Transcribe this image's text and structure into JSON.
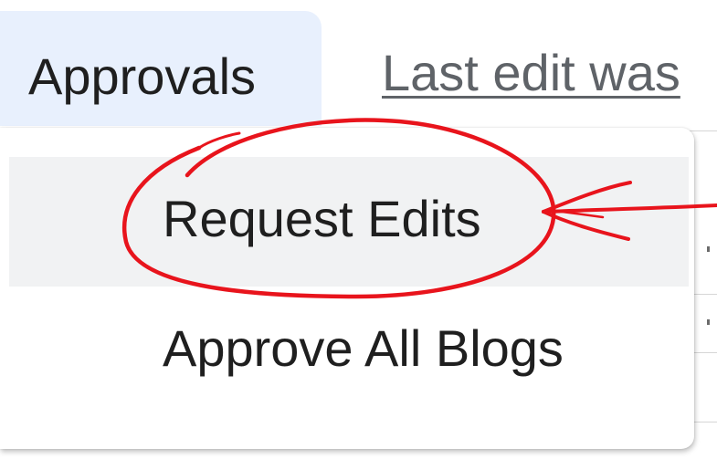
{
  "menubar": {
    "approvals_label": "Approvals",
    "last_edit_text": "Last edit was"
  },
  "dropdown": {
    "items": [
      {
        "label": "Request Edits",
        "highlighted": true
      },
      {
        "label": "Approve All Blogs",
        "highlighted": false
      }
    ]
  },
  "colors": {
    "tab_active_bg": "#e8f0fd",
    "hover_bg": "#f1f2f3",
    "annotation": "#e8141c",
    "text": "#1f1f1f",
    "link": "#5f6368"
  },
  "annotation": {
    "type": "red-ellipse-with-arrow",
    "target": "Request Edits"
  }
}
